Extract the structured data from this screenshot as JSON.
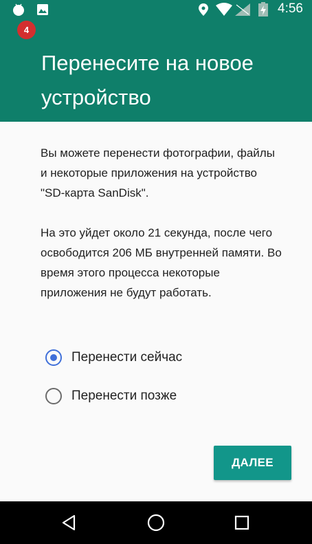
{
  "status_bar": {
    "time": "4:56",
    "notification_count": "4",
    "icons": [
      "android-icon",
      "image-icon",
      "location-icon",
      "wifi-icon",
      "signal-icon",
      "battery-icon"
    ],
    "color": "#0f7f6a"
  },
  "header": {
    "title": "Перенесите на новое устройство",
    "color": "#0f7f6a"
  },
  "content": {
    "paragraph_1": "Вы можете перенести фотографии, файлы и некоторые приложения на устройство \"SD-карта SanDisk\".",
    "paragraph_2": "На это уйдет около 21 секунда, после чего освободится 206 МБ внутренней памяти. Во время этого процесса некоторые приложения не будут работать."
  },
  "options": {
    "move_now": {
      "label": "Перенести сейчас",
      "selected": true
    },
    "move_later": {
      "label": "Перенести позже",
      "selected": false
    },
    "accent": "#3f6fd9"
  },
  "next_button": {
    "label": "ДАЛЕЕ",
    "color": "#12968a"
  },
  "nav_bar": {
    "icons": [
      "back-icon",
      "home-icon",
      "recents-icon"
    ]
  }
}
